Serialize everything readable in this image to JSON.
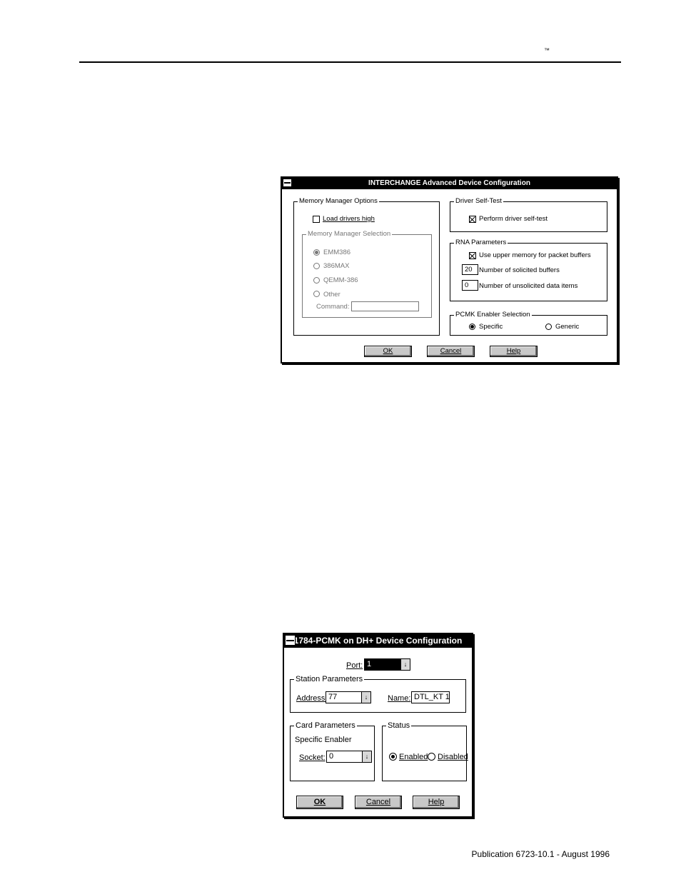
{
  "page": {
    "trademark": "™",
    "footer": "Publication 6723-10.1 - August 1996"
  },
  "advanced_dialog": {
    "title": "INTERCHANGE Advanced Device Configuration",
    "memory_manager_options": {
      "legend": "Memory Manager Options",
      "load_drivers_high": {
        "label": "Load drivers high",
        "checked": false
      },
      "selection": {
        "legend": "Memory Manager Selection",
        "options": [
          "EMM386",
          "386MAX",
          "QEMM-386",
          "Other"
        ],
        "selected": "EMM386",
        "command_label": "Command:",
        "command_value": ""
      }
    },
    "driver_self_test": {
      "legend": "Driver Self-Test",
      "perform": {
        "label": "Perform driver self-test",
        "checked": true
      }
    },
    "rna_parameters": {
      "legend": "RNA Parameters",
      "upper_memory": {
        "label": "Use upper memory for packet buffers",
        "checked": true
      },
      "solicited_buffers": {
        "value": "20",
        "label": "Number of solicited buffers"
      },
      "unsolicited_items": {
        "value": "0",
        "label": "Number of unsolicited data items"
      }
    },
    "pcmk_enabler": {
      "legend": "PCMK Enabler Selection",
      "options": [
        "Specific",
        "Generic"
      ],
      "selected": "Specific"
    },
    "buttons": {
      "ok": "OK",
      "cancel": "Cancel",
      "help": "Help"
    }
  },
  "pcmk_dialog": {
    "title": "1784-PCMK on DH+ Device Configuration",
    "port": {
      "label": "Port:",
      "value": "1"
    },
    "station_parameters": {
      "legend": "Station Parameters",
      "address_label": "Address:",
      "address_value": "77",
      "name_label": "Name:",
      "name_value": "DTL_KT 1"
    },
    "card_parameters": {
      "legend": "Card Parameters",
      "enabler": "Specific Enabler",
      "socket_label": "Socket:",
      "socket_value": "0"
    },
    "status": {
      "legend": "Status",
      "options": [
        "Enabled",
        "Disabled"
      ],
      "selected": "Enabled"
    },
    "buttons": {
      "ok": "OK",
      "cancel": "Cancel",
      "help": "Help"
    }
  },
  "icons": {
    "dropdown_arrow": "↓"
  }
}
